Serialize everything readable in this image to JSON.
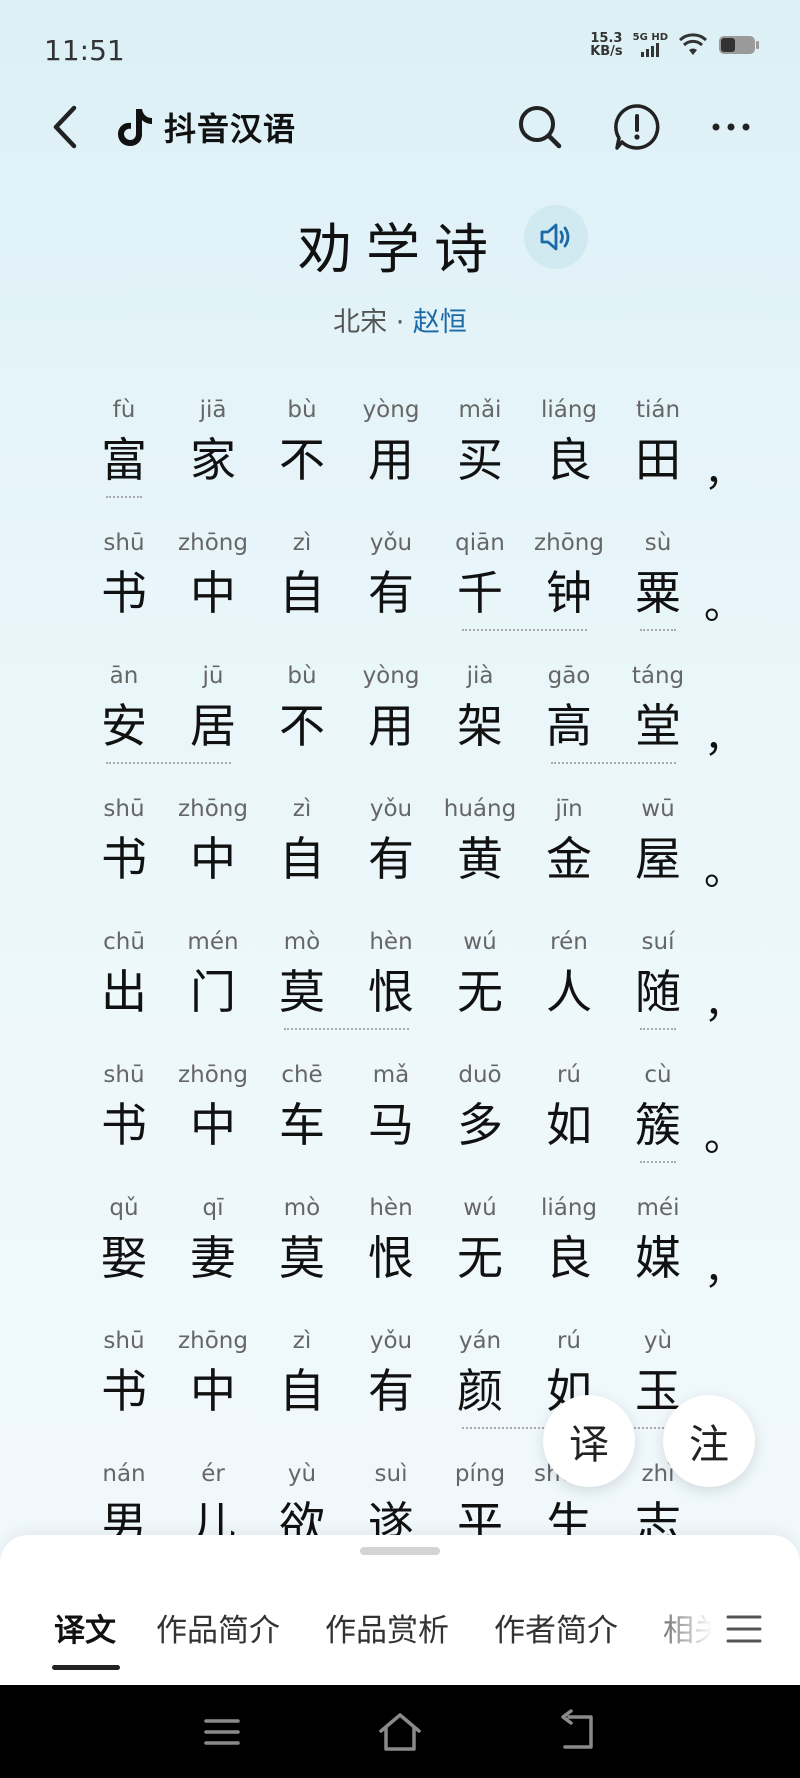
{
  "status_bar": {
    "time": "11:51",
    "net_speed_value": "15.3",
    "net_speed_unit": "KB/s",
    "network_type": "5G",
    "network_hd": "HD"
  },
  "app_bar": {
    "app_name": "抖音汉语",
    "icons": [
      "back-icon",
      "douyin-logo-icon",
      "search-icon",
      "report-icon",
      "more-icon"
    ]
  },
  "poem": {
    "title": "劝学诗",
    "dynasty": "北宋",
    "separator": "·",
    "author": "赵恒",
    "lines": [
      {
        "chars": [
          [
            "fù",
            "富"
          ],
          [
            "jiā",
            "家"
          ],
          [
            "bù",
            "不"
          ],
          [
            "yòng",
            "用"
          ],
          [
            "mǎi",
            "买"
          ],
          [
            "liáng",
            "良"
          ],
          [
            "tián",
            "田"
          ]
        ],
        "punct": "，"
      },
      {
        "chars": [
          [
            "shū",
            "书"
          ],
          [
            "zhōng",
            "中"
          ],
          [
            "zì",
            "自"
          ],
          [
            "yǒu",
            "有"
          ],
          [
            "qiān",
            "千"
          ],
          [
            "zhōng",
            "钟"
          ],
          [
            "sù",
            "粟"
          ]
        ],
        "punct": "。"
      },
      {
        "chars": [
          [
            "ān",
            "安"
          ],
          [
            "jū",
            "居"
          ],
          [
            "bù",
            "不"
          ],
          [
            "yòng",
            "用"
          ],
          [
            "jià",
            "架"
          ],
          [
            "gāo",
            "高"
          ],
          [
            "táng",
            "堂"
          ]
        ],
        "punct": "，"
      },
      {
        "chars": [
          [
            "shū",
            "书"
          ],
          [
            "zhōng",
            "中"
          ],
          [
            "zì",
            "自"
          ],
          [
            "yǒu",
            "有"
          ],
          [
            "huáng",
            "黄"
          ],
          [
            "jīn",
            "金"
          ],
          [
            "wū",
            "屋"
          ]
        ],
        "punct": "。"
      },
      {
        "chars": [
          [
            "chū",
            "出"
          ],
          [
            "mén",
            "门"
          ],
          [
            "mò",
            "莫"
          ],
          [
            "hèn",
            "恨"
          ],
          [
            "wú",
            "无"
          ],
          [
            "rén",
            "人"
          ],
          [
            "suí",
            "随"
          ]
        ],
        "punct": "，"
      },
      {
        "chars": [
          [
            "shū",
            "书"
          ],
          [
            "zhōng",
            "中"
          ],
          [
            "chē",
            "车"
          ],
          [
            "mǎ",
            "马"
          ],
          [
            "duō",
            "多"
          ],
          [
            "rú",
            "如"
          ],
          [
            "cù",
            "簇"
          ]
        ],
        "punct": "。"
      },
      {
        "chars": [
          [
            "qǔ",
            "娶"
          ],
          [
            "qī",
            "妻"
          ],
          [
            "mò",
            "莫"
          ],
          [
            "hèn",
            "恨"
          ],
          [
            "wú",
            "无"
          ],
          [
            "liáng",
            "良"
          ],
          [
            "méi",
            "媒"
          ]
        ],
        "punct": "，"
      },
      {
        "chars": [
          [
            "shū",
            "书"
          ],
          [
            "zhōng",
            "中"
          ],
          [
            "zì",
            "自"
          ],
          [
            "yǒu",
            "有"
          ],
          [
            "yán",
            "颜"
          ],
          [
            "rú",
            "如"
          ],
          [
            "yù",
            "玉"
          ]
        ],
        "punct": ""
      },
      {
        "chars": [
          [
            "nán",
            "男"
          ],
          [
            "ér",
            "儿"
          ],
          [
            "yù",
            "欲"
          ],
          [
            "suì",
            "遂"
          ],
          [
            "píng",
            "平"
          ],
          [
            "shēng",
            "生"
          ],
          [
            "zhì",
            "志"
          ]
        ],
        "punct": ""
      }
    ]
  },
  "fabs": {
    "translate": "译",
    "annotate": "注"
  },
  "tabs": [
    {
      "label": "译文",
      "active": true
    },
    {
      "label": "作品简介",
      "active": false
    },
    {
      "label": "作品赏析",
      "active": false
    },
    {
      "label": "作者简介",
      "active": false
    },
    {
      "label": "相关",
      "active": false
    }
  ],
  "nav_icons": [
    "menu-icon",
    "home-icon",
    "back-nav-icon"
  ]
}
